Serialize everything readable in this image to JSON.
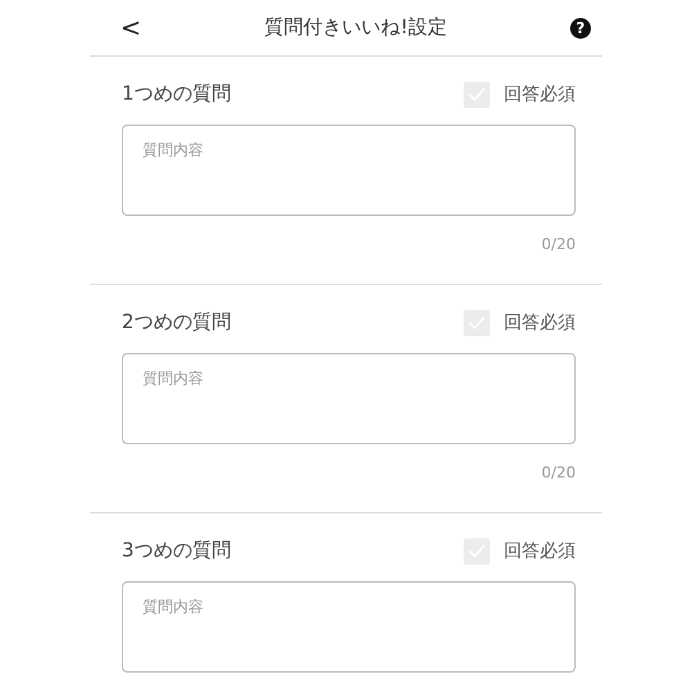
{
  "header": {
    "back": "<",
    "title": "質問付きいいね!設定",
    "help": "?"
  },
  "questions": [
    {
      "title": "1つめの質問",
      "required_label": "回答必須",
      "checked": true,
      "placeholder": "質問内容",
      "counter": "0/20"
    },
    {
      "title": "2つめの質問",
      "required_label": "回答必須",
      "checked": true,
      "placeholder": "質問内容",
      "counter": "0/20"
    },
    {
      "title": "3つめの質問",
      "required_label": "回答必須",
      "checked": true,
      "placeholder": "質問内容"
    }
  ]
}
